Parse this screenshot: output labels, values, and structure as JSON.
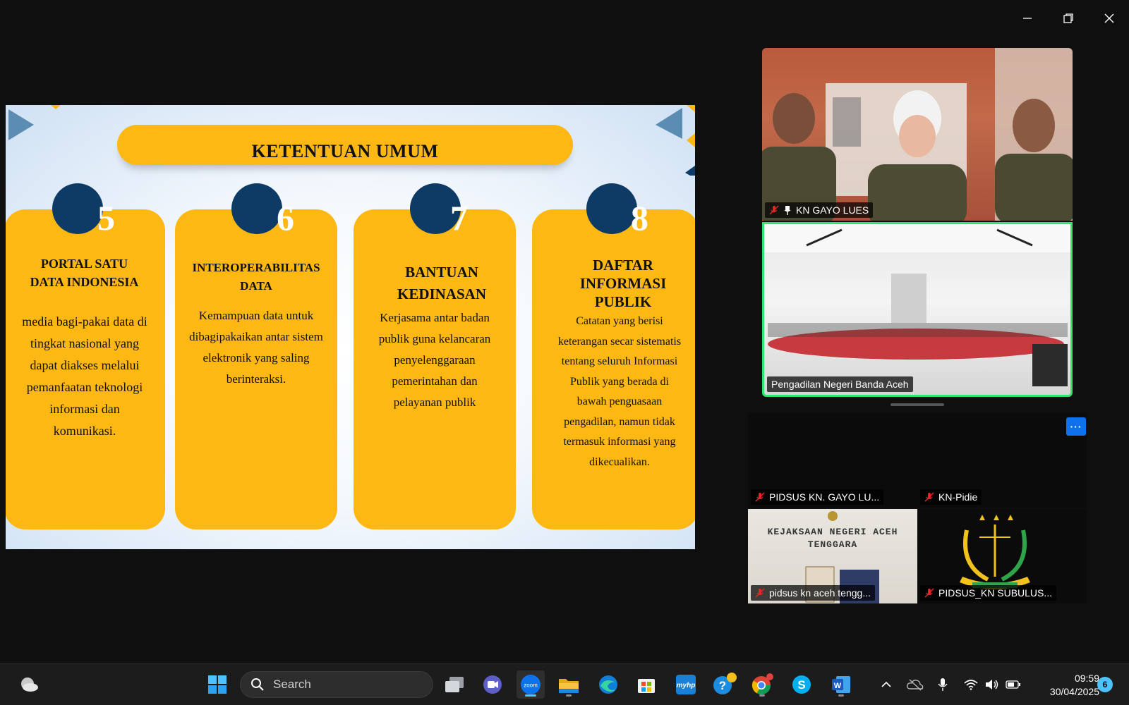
{
  "slide": {
    "title": "KETENTUAN UMUM",
    "cards": [
      {
        "number": "5",
        "title": "PORTAL SATU DATA INDONESIA",
        "body": "media bagi-pakai data di tingkat nasional yang dapat diakses melalui pemanfaatan teknologi informasi dan komunikasi."
      },
      {
        "number": "6",
        "title": "INTEROPERABILITAS DATA",
        "body": "Kemampuan data untuk dibagipakaikan antar sistem elektronik yang saling berinteraksi."
      },
      {
        "number": "7",
        "title": "BANTUAN KEDINASAN",
        "body": "Kerjasama antar badan publik guna kelancaran penyelenggaraan pemerintahan dan pelayanan publik"
      },
      {
        "number": "8",
        "title": "DAFTAR INFORMASI PUBLIK",
        "body": "Catatan yang berisi keterangan secar sistematis tentang seluruh Informasi Publik yang berada di bawah penguasaan pengadilan, namun tidak termasuk informasi yang dikecualikan."
      }
    ],
    "colors": {
      "card": "#fdb813",
      "circle": "#0d3b66"
    }
  },
  "participants": [
    {
      "name": "KN GAYO LUES",
      "muted": true,
      "pinned": true
    },
    {
      "name": "Pengadilan Negeri Banda Aceh",
      "muted": false,
      "active_speaker": true
    },
    {
      "name": "PIDSUS KN. GAYO LU...",
      "muted": true
    },
    {
      "name": "KN-Pidie",
      "muted": true
    },
    {
      "name": "pidsus kn aceh tengg...",
      "muted": true,
      "sign_text": "KEJAKSAAN NEGERI ACEH TENGGARA"
    },
    {
      "name": "PIDSUS_KN SUBULUS...",
      "muted": true
    }
  ],
  "more_label": "···",
  "taskbar": {
    "search_label": "Search",
    "time": "09:59",
    "date": "30/04/2025",
    "notification_count": "6",
    "apps": [
      "weather-icon",
      "windows-start-icon",
      "search-icon",
      "task-view-icon",
      "meet-icon",
      "zoom-icon",
      "file-explorer-icon",
      "edge-icon",
      "store-icon",
      "myhp-icon",
      "help-icon",
      "chrome-icon",
      "skype-icon",
      "word-icon"
    ],
    "zoom_label": "zoom",
    "myhp_label": "myhp",
    "skype_label": "S",
    "word_label": "W"
  },
  "accent": {
    "active_speaker_border": "#2ee66b",
    "zoom_blue": "#0e72ed"
  }
}
